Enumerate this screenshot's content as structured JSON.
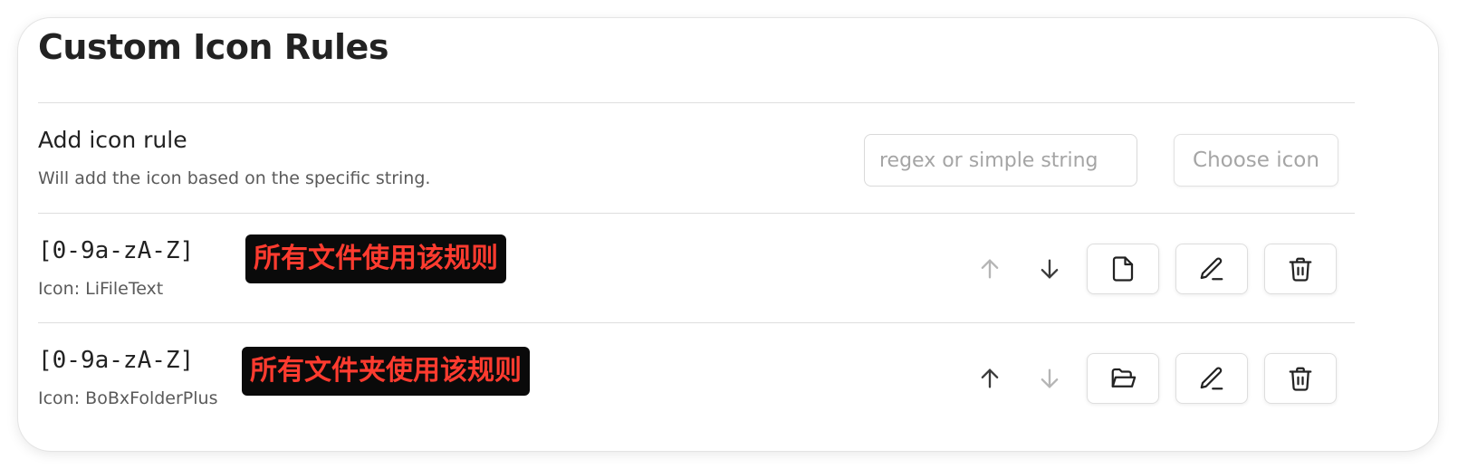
{
  "title": "Custom Icon Rules",
  "add_rule": {
    "name": "Add icon rule",
    "description": "Will add the icon based on the specific string.",
    "input_placeholder": "regex or simple string",
    "input_value": "",
    "choose_icon_label": "Choose icon"
  },
  "rules": [
    {
      "pattern": "[0-9a-zA-Z]",
      "icon_text": "Icon: LiFileText",
      "annotation": "所有文件使用该规则",
      "icon": "file-text-icon",
      "move_up_enabled": false,
      "move_down_enabled": true
    },
    {
      "pattern": "[0-9a-zA-Z]",
      "icon_text": "Icon: BoBxFolderPlus",
      "annotation": "所有文件夹使用该规则",
      "icon": "folder-open-icon",
      "move_up_enabled": true,
      "move_down_enabled": false
    }
  ],
  "colors": {
    "annotation_bg": "#0a0a0a",
    "annotation_text": "#ff3b2f",
    "disabled_arrow": "#b5b5b5"
  }
}
